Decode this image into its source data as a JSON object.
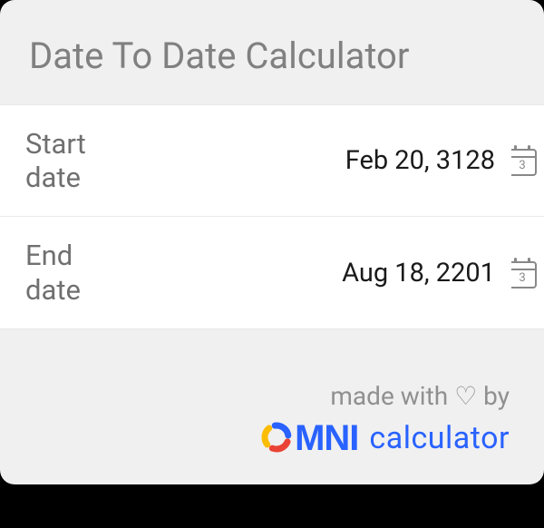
{
  "title": "Date To Date Calculator",
  "fields": {
    "start": {
      "label": "Start date",
      "value": "Feb 20, 3128",
      "iconDay": "3"
    },
    "end": {
      "label": "End date",
      "value": "Aug 18, 2201",
      "iconDay": "3"
    }
  },
  "footer": {
    "madeWith": "made with ♡ by",
    "brandName": "MNI",
    "brandSuffix": "calculator"
  }
}
